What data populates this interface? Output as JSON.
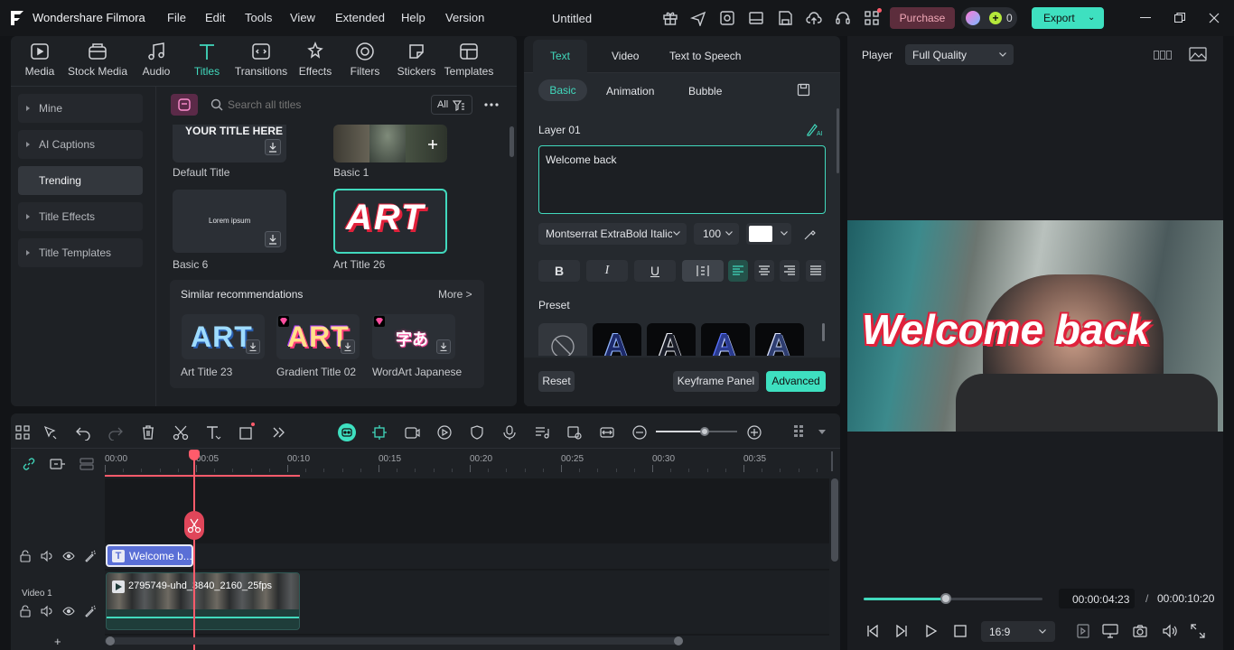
{
  "app": {
    "name": "Wondershare Filmora",
    "project_title": "Untitled"
  },
  "menu": [
    "File",
    "Edit",
    "Tools",
    "View",
    "Extended",
    "Help",
    "Version"
  ],
  "titlebar": {
    "purchase_label": "Purchase",
    "credits": "0",
    "export_label": "Export"
  },
  "tool_tabs": [
    {
      "label": "Media",
      "icon": "media-icon"
    },
    {
      "label": "Stock Media",
      "icon": "stock-media-icon"
    },
    {
      "label": "Audio",
      "icon": "audio-icon"
    },
    {
      "label": "Titles",
      "icon": "titles-icon",
      "active": true
    },
    {
      "label": "Transitions",
      "icon": "transitions-icon"
    },
    {
      "label": "Effects",
      "icon": "effects-icon"
    },
    {
      "label": "Filters",
      "icon": "filters-icon"
    },
    {
      "label": "Stickers",
      "icon": "stickers-icon"
    },
    {
      "label": "Templates",
      "icon": "templates-icon"
    }
  ],
  "sidebar": [
    "Mine",
    "AI Captions",
    "Trending",
    "Title Effects",
    "Title Templates"
  ],
  "search": {
    "placeholder": "Search all titles",
    "filter_label": "All"
  },
  "titles": {
    "default_title_text": "YOUR TITLE HERE",
    "default_title": "Default Title",
    "basic1": "Basic 1",
    "basic6_preview": "Lorem ipsum",
    "basic6": "Basic 6",
    "art26_preview": "ART",
    "art26": "Art Title 26"
  },
  "similar": {
    "heading": "Similar recommendations",
    "more": "More >",
    "items": [
      {
        "label": "Art Title 23",
        "preview": "ART"
      },
      {
        "label": "Gradient Title 02",
        "preview": "ART"
      },
      {
        "label": "WordArt Japanese",
        "preview": "字あ"
      }
    ]
  },
  "editor": {
    "tabs": [
      "Text",
      "Video",
      "Text to Speech"
    ],
    "subtabs": [
      "Basic",
      "Animation",
      "Bubble"
    ],
    "layer_label": "Layer 01",
    "text_value": "Welcome back",
    "font": "Montserrat ExtraBold Italic",
    "size": "100",
    "format": [
      "B",
      "I",
      "U"
    ],
    "preset_label": "Preset",
    "preset_glyph": "A",
    "reset": "Reset",
    "keyframe": "Keyframe Panel",
    "advanced": "Advanced"
  },
  "player": {
    "label": "Player",
    "quality": "Full Quality",
    "overlay_text": "Welcome back",
    "current_time": "00:00:04:23",
    "separator": "/",
    "total_time": "00:00:10:20",
    "aspect": "16:9",
    "progress": 0.46
  },
  "timeline": {
    "ruler": [
      "00:00",
      "00:05",
      "00:10",
      "00:15",
      "00:20",
      "00:25",
      "00:30",
      "00:35"
    ],
    "title_clip": "Welcome b...",
    "video_clip": "2795749-uhd_3840_2160_25fps",
    "video_track_label": "Video 1",
    "add": "+",
    "zoom_level": 0.6
  },
  "colors": {
    "accent": "#3ee0c0",
    "playhead": "#ff5b6b",
    "title_clip": "#5a6fd6",
    "art_red": "#e0213b"
  }
}
